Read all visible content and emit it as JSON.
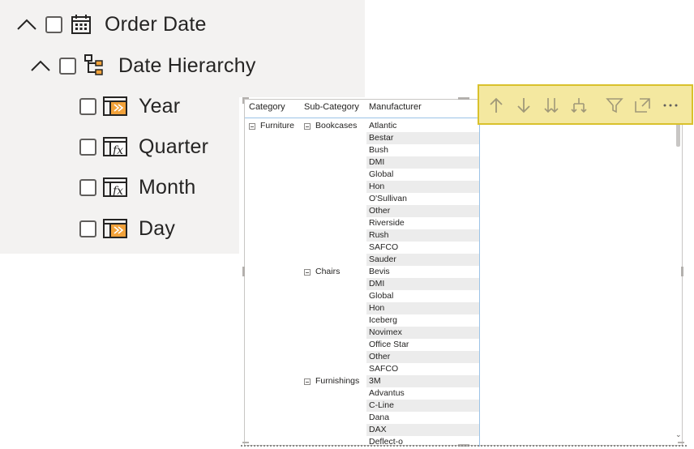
{
  "fields": {
    "table": {
      "label": "Order Date",
      "icon": "calendar-icon",
      "expanded": true
    },
    "hierarchy": {
      "label": "Date Hierarchy",
      "icon": "hierarchy-icon",
      "expanded": true
    },
    "levels": [
      {
        "label": "Year",
        "icon": "calendar-table-icon"
      },
      {
        "label": "Quarter",
        "icon": "calculated-column-icon"
      },
      {
        "label": "Month",
        "icon": "calculated-column-icon"
      },
      {
        "label": "Day",
        "icon": "calendar-table-icon"
      }
    ]
  },
  "matrix": {
    "headers": {
      "category": "Category",
      "subcategory": "Sub-Category",
      "manufacturer": "Manufacturer"
    },
    "category": "Furniture",
    "groups": [
      {
        "subcategory": "Bookcases",
        "manufacturers": [
          "Atlantic",
          "Bestar",
          "Bush",
          "DMI",
          "Global",
          "Hon",
          "O'Sullivan",
          "Other",
          "Riverside",
          "Rush",
          "SAFCO",
          "Sauder"
        ]
      },
      {
        "subcategory": "Chairs",
        "manufacturers": [
          "Bevis",
          "DMI",
          "Global",
          "Hon",
          "Iceberg",
          "Novimex",
          "Office Star",
          "Other",
          "SAFCO"
        ]
      },
      {
        "subcategory": "Furnishings",
        "manufacturers": [
          "3M",
          "Advantus",
          "C-Line",
          "Dana",
          "DAX",
          "Deflect-o"
        ]
      }
    ]
  },
  "toolbar": {
    "tools": [
      {
        "name": "drill-up-icon"
      },
      {
        "name": "drill-down-icon"
      },
      {
        "name": "go-to-next-level-icon"
      },
      {
        "name": "expand-next-level-icon"
      },
      {
        "name": "filter-icon"
      },
      {
        "name": "focus-mode-icon"
      },
      {
        "name": "more-options-icon"
      }
    ]
  },
  "colors": {
    "pane_bg": "#f3f2f1",
    "toolbar_bg": "#f4e8a0",
    "toolbar_border": "#d9c12c",
    "accent_icon": "#f2a23a",
    "grid_line": "#9cc3e6"
  }
}
